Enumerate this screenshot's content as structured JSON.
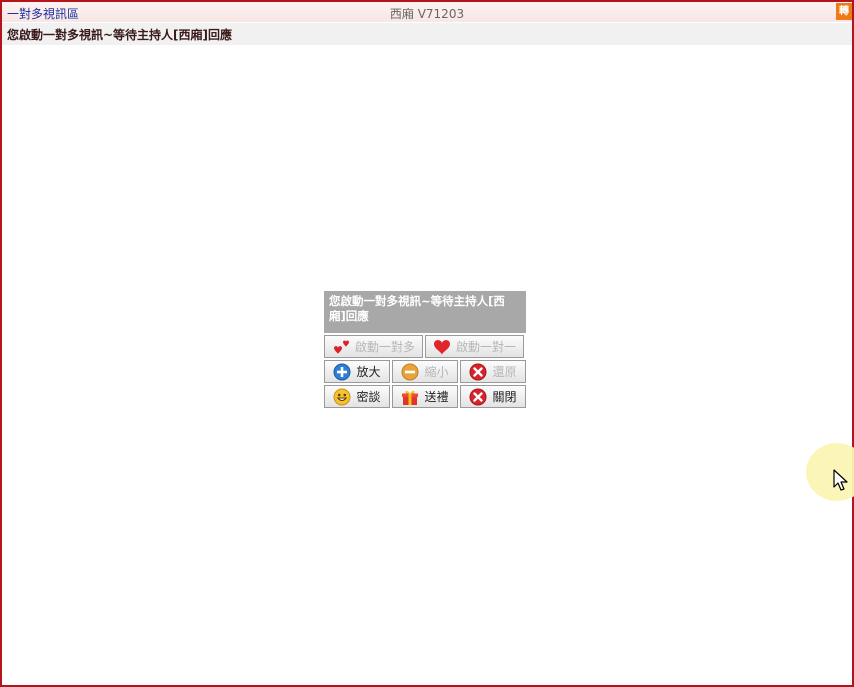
{
  "window": {
    "left_title": "一對多視訊區",
    "center_title": "西廂 V71203",
    "corner_button": "轉"
  },
  "status": {
    "text": "您啟動一對多視訊~等待主持人[西廂]回應"
  },
  "panel": {
    "message": "您啟動一對多視訊~等待主持人[西廂]回應",
    "buttons": {
      "start_one_to_many": "啟動一對多",
      "start_one_to_one": "啟動一對一",
      "zoom_in": "放大",
      "zoom_out": "縮小",
      "restore": "還原",
      "private_chat": "密談",
      "send_gift": "送禮",
      "close": "關閉"
    }
  },
  "colors": {
    "frame_border": "#b4141b",
    "title_link": "#1b2fa0",
    "corner_button_bg": "#f07a18",
    "panel_message_bg": "#a8a8a8",
    "cursor_highlight": "#fbf5b3"
  },
  "icons": {
    "start_one_to_many": "small-hearts-icon",
    "start_one_to_one": "heart-icon",
    "zoom_in": "plus-circle-icon",
    "zoom_out": "minus-circle-icon",
    "restore": "x-circle-icon",
    "private_chat": "smiley-icon",
    "send_gift": "gift-icon",
    "close": "x-circle-icon"
  }
}
